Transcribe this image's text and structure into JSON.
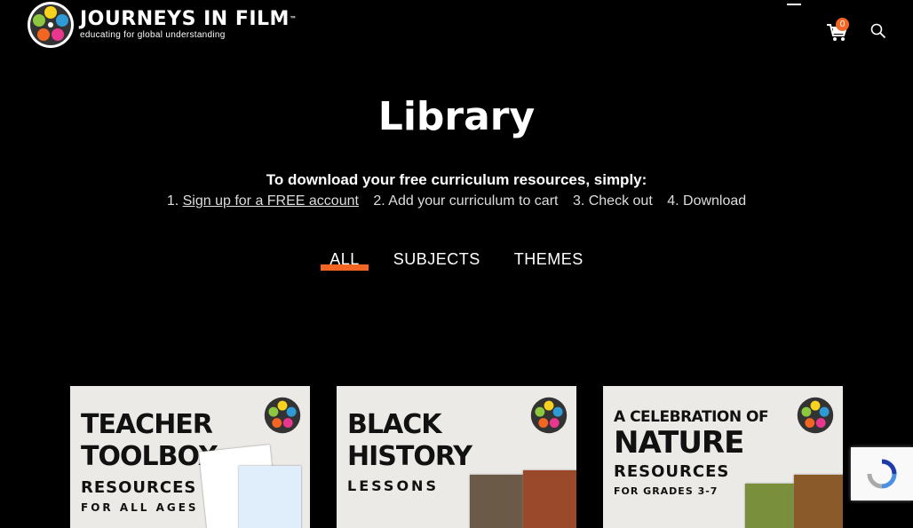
{
  "header": {
    "logo_title": "JOURNEYS IN FILM",
    "logo_tm": "™",
    "logo_tagline": "educating for global understanding",
    "cart_count": "0",
    "icons": [
      "film-reel-logo",
      "menu-icon",
      "cart-icon",
      "search-icon"
    ]
  },
  "page": {
    "title": "Library",
    "intro": "To download your free curriculum resources, simply:",
    "steps": {
      "s1_prefix": "1. ",
      "s1_link": "Sign up for a FREE account",
      "s2": "2. Add your curriculum to cart",
      "s3": "3. Check out",
      "s4": "4. Download"
    }
  },
  "filters": [
    {
      "label": "ALL",
      "active": true
    },
    {
      "label": "SUBJECTS",
      "active": false
    },
    {
      "label": "THEMES",
      "active": false
    }
  ],
  "cards": [
    {
      "line1": "TEACHER",
      "line2": "TOOLBOX",
      "line3": "RESOURCES",
      "line4": "FOR ALL AGES"
    },
    {
      "line1": "BLACK",
      "line2": "HISTORY",
      "line3": "LESSONS"
    },
    {
      "line1": "A CELEBRATION OF",
      "line2": "NATURE",
      "line3": "RESOURCES",
      "line4": "FOR GRADES 3-7"
    }
  ],
  "colors": {
    "accent": "#f26522",
    "background": "#000000"
  }
}
